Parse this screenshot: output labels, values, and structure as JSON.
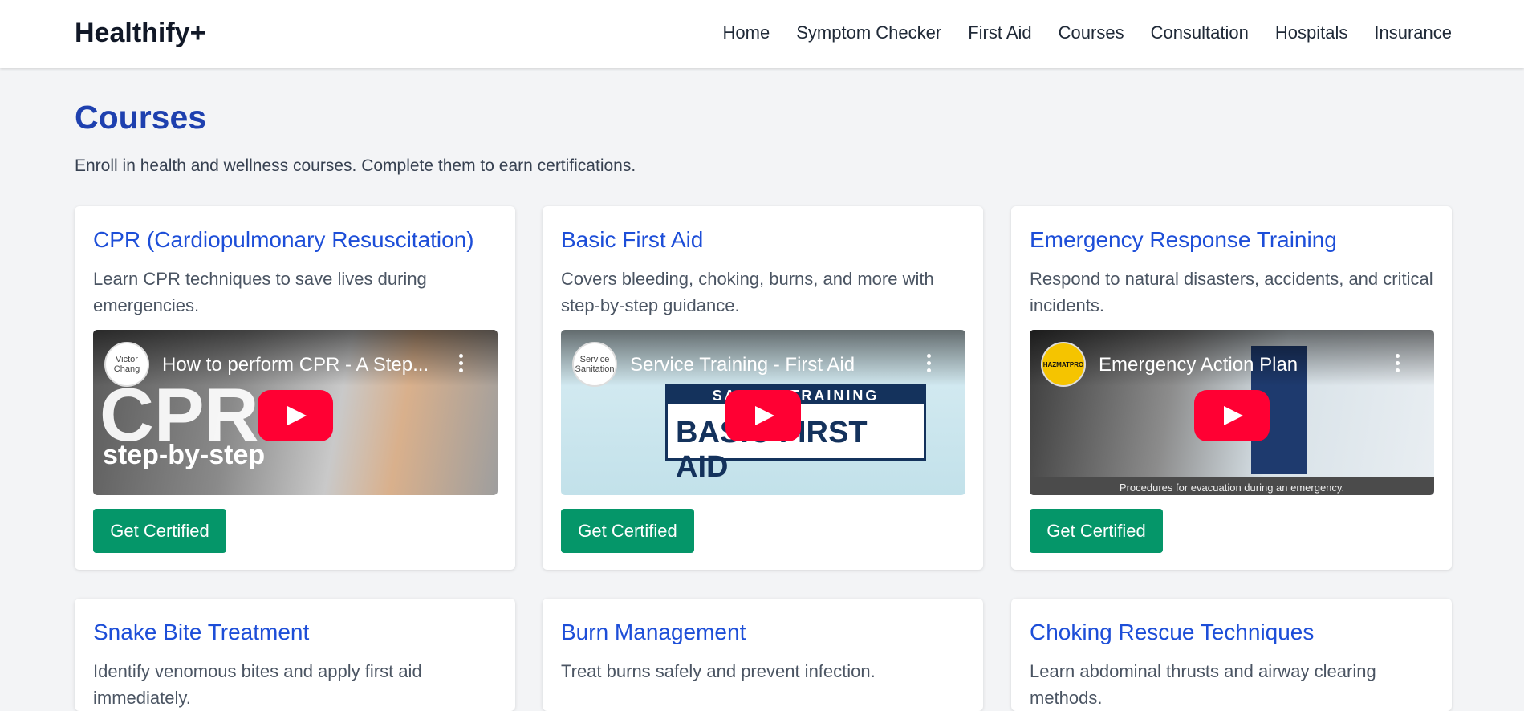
{
  "brand": "Healthify+",
  "nav": [
    "Home",
    "Symptom Checker",
    "First Aid",
    "Courses",
    "Consultation",
    "Hospitals",
    "Insurance"
  ],
  "page": {
    "title": "Courses",
    "description": "Enroll in health and wellness courses. Complete them to earn certifications."
  },
  "courses": [
    {
      "title": "CPR (Cardiopulmonary Resuscitation)",
      "description": "Learn CPR techniques to save lives during emergencies.",
      "video_title": "How to perform CPR - A Step...",
      "channel": "Victor Chang",
      "overlay_big": "CPR",
      "overlay_small": "step-by-step",
      "button": "Get Certified"
    },
    {
      "title": "Basic First Aid",
      "description": "Covers bleeding, choking, burns, and more with step-by-step guidance.",
      "video_title": "Service Training - First Aid",
      "channel": "Service Sanitation",
      "banner_top": "SAFETY TRAINING",
      "banner_main": "BASIC FIRST AID",
      "button": "Get Certified"
    },
    {
      "title": "Emergency Response Training",
      "description": "Respond to natural disasters, accidents, and critical incidents.",
      "video_title": "Emergency Action Plan",
      "channel": "HAZMATPRO",
      "caption": "Procedures for evacuation during an emergency.",
      "button": "Get Certified"
    },
    {
      "title": "Snake Bite Treatment",
      "description": "Identify venomous bites and apply first aid immediately."
    },
    {
      "title": "Burn Management",
      "description": "Treat burns safely and prevent infection."
    },
    {
      "title": "Choking Rescue Techniques",
      "description": "Learn abdominal thrusts and airway clearing methods."
    }
  ]
}
